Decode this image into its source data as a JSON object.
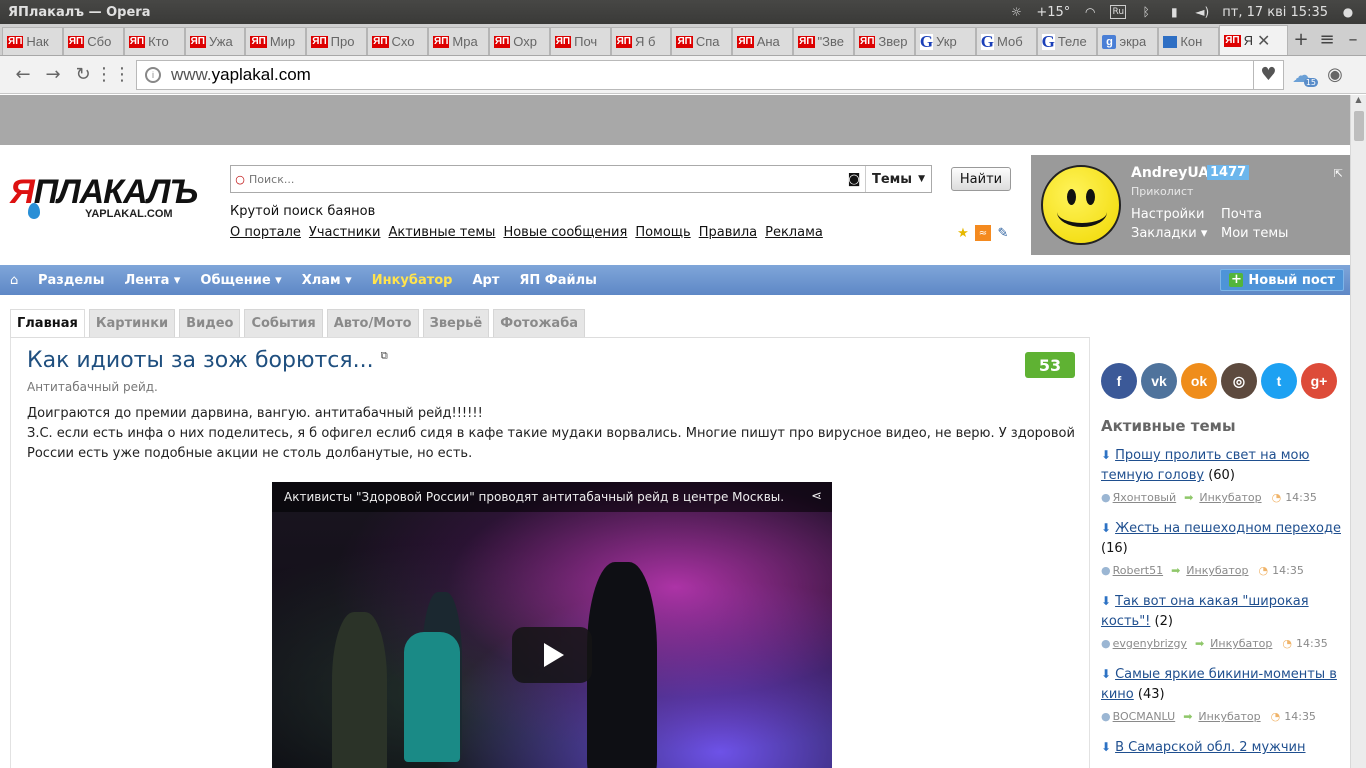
{
  "os": {
    "window_title": "ЯПлакалъ — Opera",
    "weather": "+15°",
    "datetime": "пт, 17 кві 15:35",
    "kb_layout": "Ru"
  },
  "tabs": [
    {
      "icon": "ЯП",
      "label": "Нак"
    },
    {
      "icon": "ЯП",
      "label": "Сбо"
    },
    {
      "icon": "ЯП",
      "label": "Кто"
    },
    {
      "icon": "ЯП",
      "label": "Ужа"
    },
    {
      "icon": "ЯП",
      "label": "Мир"
    },
    {
      "icon": "ЯП",
      "label": "Про"
    },
    {
      "icon": "ЯП",
      "label": "Схо"
    },
    {
      "icon": "ЯП",
      "label": "Мра"
    },
    {
      "icon": "ЯП",
      "label": "Охр"
    },
    {
      "icon": "ЯП",
      "label": "Поч"
    },
    {
      "icon": "ЯП",
      "label": "Я б"
    },
    {
      "icon": "ЯП",
      "label": "Спа"
    },
    {
      "icon": "ЯП",
      "label": "Ана"
    },
    {
      "icon": "ЯП",
      "label": "\"Зве"
    },
    {
      "icon": "ЯП",
      "label": "Звер"
    },
    {
      "icon": "G",
      "label": "Укр"
    },
    {
      "icon": "G",
      "label": "Моб"
    },
    {
      "icon": "G",
      "label": "Теле"
    },
    {
      "icon": "g",
      "label": "экра"
    },
    {
      "icon": "doc",
      "label": "Кон"
    },
    {
      "icon": "ЯП",
      "label": "Я"
    }
  ],
  "address": {
    "prefix": "www.",
    "host": "yaplakal.com",
    "badge": "15"
  },
  "header": {
    "logo_main": "ЯПЛАКАЛЪ",
    "logo_sub": "YAPLAKAL.COM",
    "search_placeholder": "Поиск...",
    "search_scope": "Темы",
    "find_label": "Найти",
    "tagline": "Крутой поиск баянов",
    "links": [
      "О портале",
      "Участники",
      "Активные темы",
      "Новые сообщения",
      "Помощь",
      "Правила",
      "Реклама"
    ]
  },
  "user": {
    "name": "AndreyUA",
    "reputation": "1477",
    "role": "Приколист",
    "links": [
      "Настройки",
      "Почта",
      "Закладки ▾",
      "Мои темы"
    ]
  },
  "mainnav": {
    "items": [
      "Разделы",
      "Лента ▾",
      "Общение ▾",
      "Хлам ▾",
      "Инкубатор",
      "Арт",
      "ЯП Файлы"
    ],
    "new_post": "Новый пост"
  },
  "category_tabs": [
    "Главная",
    "Картинки",
    "Видео",
    "События",
    "Авто/Мото",
    "Зверьё",
    "Фотожаба"
  ],
  "post": {
    "title": "Как идиоты за зож борются...",
    "subtitle": "Антитабачный рейд.",
    "rating": "53",
    "body_1": "Доиграются до премии дарвина, вангую. антитабачный рейд!!!!!!",
    "body_2": "З.С. если есть инфа о них поделитесь, я б офигел еслиб сидя в кафе такие мудаки ворвались. Многие пишут про вирусное видео, не верю. У здоровой России есть уже подобные акции не столь долбанутые, но есть.",
    "video_title": "Активисты \"Здоровой России\" проводят антитабачный рейд в центре Москвы."
  },
  "sidebar": {
    "socials": [
      {
        "icon": "facebook-icon",
        "glyph": "f",
        "color": "#3b5998"
      },
      {
        "icon": "vk-icon",
        "glyph": "vk",
        "color": "#4f739c"
      },
      {
        "icon": "odnoklassniki-icon",
        "glyph": "ok",
        "color": "#ef8d1b"
      },
      {
        "icon": "instagram-icon",
        "glyph": "◎",
        "color": "#5d4a3e"
      },
      {
        "icon": "twitter-icon",
        "glyph": "t",
        "color": "#1da1f2"
      },
      {
        "icon": "google-plus-icon",
        "glyph": "g+",
        "color": "#dd4b39"
      }
    ],
    "active_title": "Активные темы",
    "topics": [
      {
        "title": "Прошу пролить свет на мою темную голову",
        "count": "(60)",
        "author": "Яхонтовый",
        "section": "Инкубатор",
        "time": "14:35"
      },
      {
        "title": "Жесть на пешеходном переходе",
        "count": "(16)",
        "author": "Robert51",
        "section": "Инкубатор",
        "time": "14:35"
      },
      {
        "title": "Так вот она какая \"широкая кость\"!",
        "count": "(2)",
        "author": "evgenybrizgy",
        "section": "Инкубатор",
        "time": "14:35"
      },
      {
        "title": "Самые яркие бикини-моменты в кино",
        "count": "(43)",
        "author": "BOCMANLU",
        "section": "Инкубатор",
        "time": "14:35"
      },
      {
        "title": "В Самарской обл. 2 мужчин",
        "count": "",
        "author": "",
        "section": "",
        "time": ""
      }
    ]
  }
}
